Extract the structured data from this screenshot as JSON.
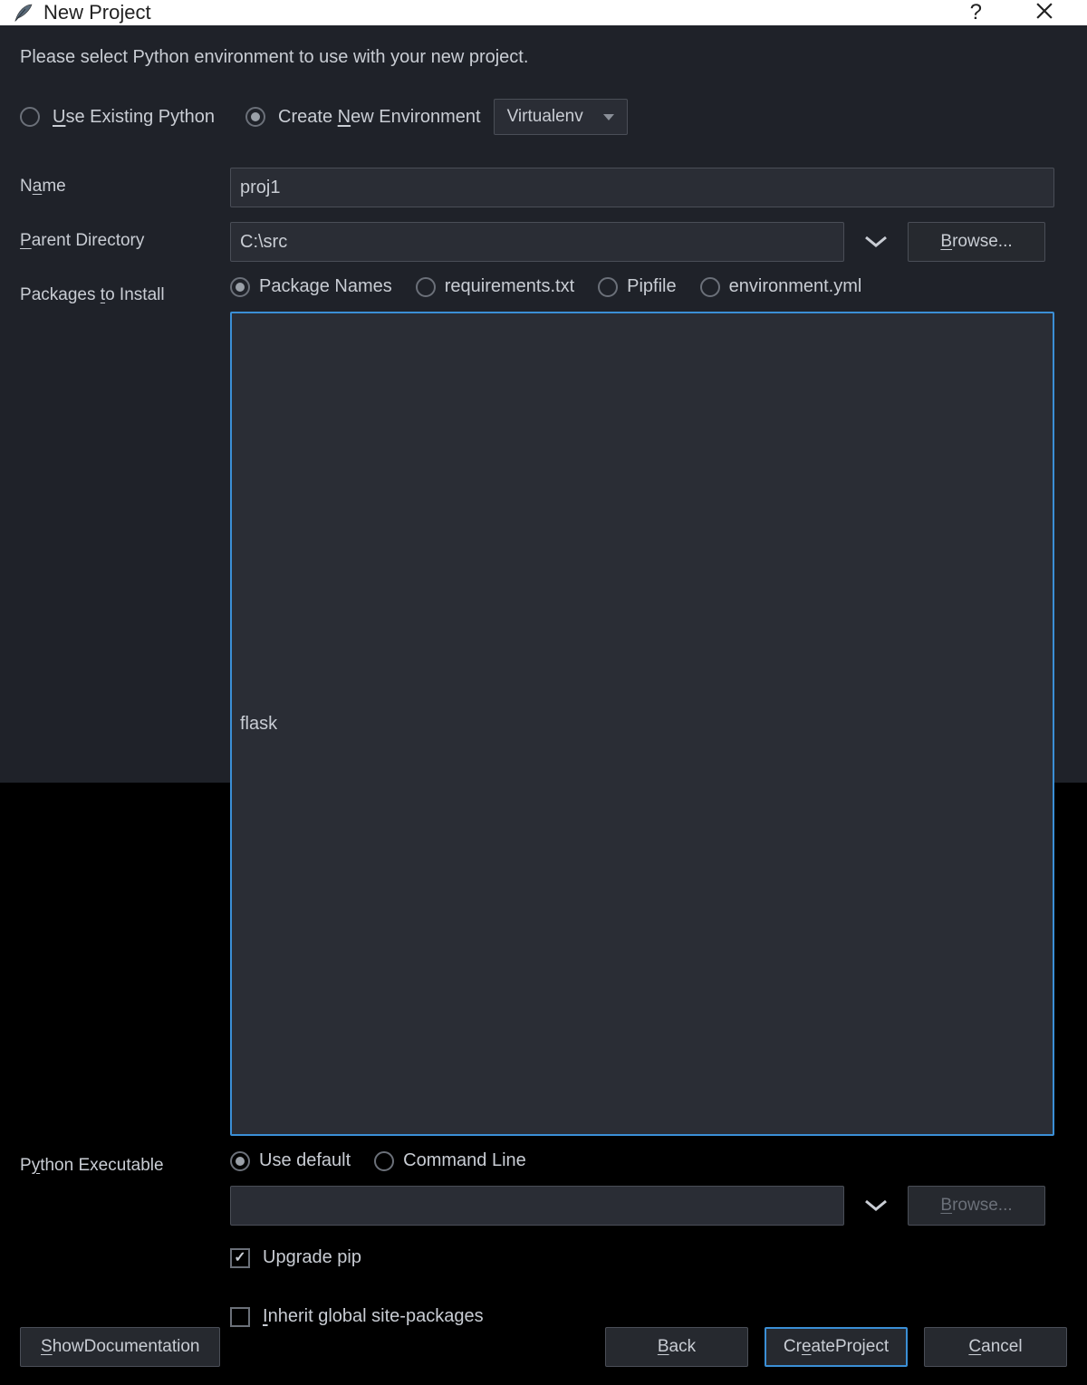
{
  "titlebar": {
    "title": "New Project",
    "help_glyph": "?"
  },
  "instruction": "Please select Python environment to use with your new project.",
  "env": {
    "use_existing_label": "Use Existing Python",
    "create_new_label": "Create New Environment",
    "selected": "create_new",
    "env_type_selected": "Virtualenv"
  },
  "fields": {
    "name": {
      "label": "Name",
      "value": "proj1"
    },
    "parent_dir": {
      "label": "Parent Directory",
      "value": "C:\\src",
      "browse_label": "Browse..."
    },
    "packages": {
      "label": "Packages to Install",
      "options": {
        "package_names": "Package Names",
        "requirements": "requirements.txt",
        "pipfile": "Pipfile",
        "env_yml": "environment.yml"
      },
      "selected": "package_names",
      "value": "flask"
    },
    "python_exec": {
      "label": "Python Executable",
      "options": {
        "use_default": "Use default",
        "command_line": "Command Line"
      },
      "selected": "use_default",
      "value": "",
      "browse_label": "Browse..."
    },
    "upgrade_pip": {
      "label": "Upgrade pip",
      "checked": true
    },
    "inherit_global": {
      "label": "Inherit global site-packages",
      "checked": false
    }
  },
  "footer": {
    "show_docs": "Show Documentation",
    "back": "Back",
    "create": "Create Project",
    "cancel": "Cancel"
  }
}
